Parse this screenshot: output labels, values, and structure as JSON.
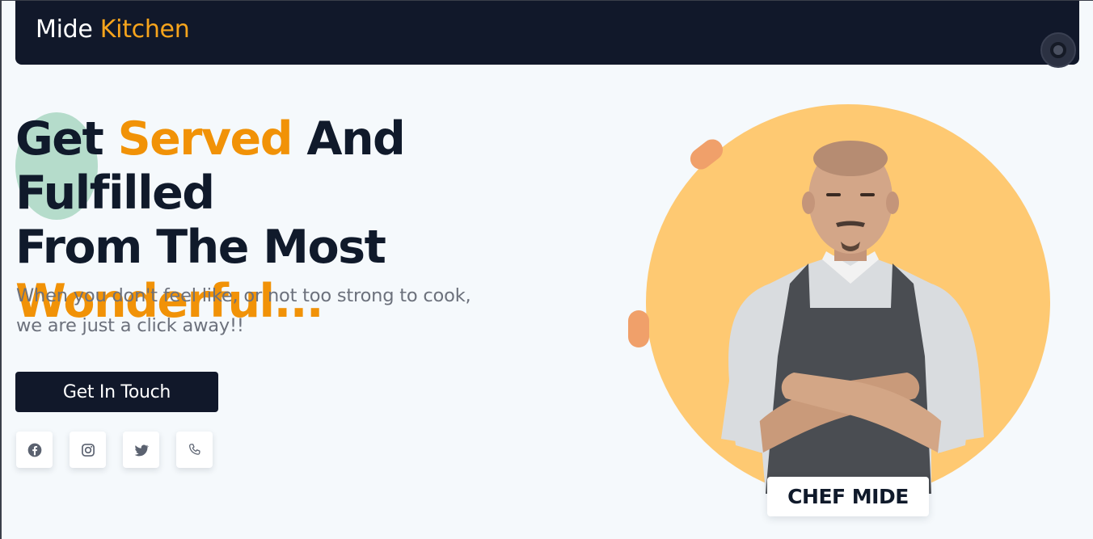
{
  "header": {
    "brand_part1": "Mide",
    "brand_part2": "Kitchen"
  },
  "hero": {
    "headline_word1": "Get",
    "headline_accent1": "Served",
    "headline_rest1": "And Fulfilled",
    "headline_line2": "From The Most",
    "headline_accent2": "Wonderful...",
    "subtext_line1": "When you don't feel like, or not too strong to cook,",
    "subtext_line2": "we are just a click away!!",
    "cta_label": "Get In Touch"
  },
  "socials": [
    {
      "icon": "facebook-icon"
    },
    {
      "icon": "instagram-icon"
    },
    {
      "icon": "twitter-icon"
    },
    {
      "icon": "phone-icon"
    }
  ],
  "chef": {
    "label": "CHEF MIDE"
  },
  "colors": {
    "navy": "#11182a",
    "accent_orange": "#f19207",
    "brand_yellow": "#f7a41c",
    "circle_yellow": "#fec972",
    "pill_orange": "#f0a06a",
    "blob_green": "#b5dccb",
    "background": "#f5f9fc"
  }
}
